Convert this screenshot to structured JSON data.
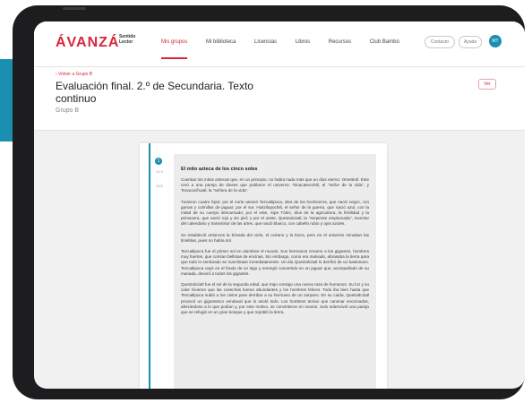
{
  "header": {
    "logo": "ÁVANZÁ",
    "logo_sub": "Sentido Lector",
    "nav": [
      "Mis grupos",
      "Mi biblioteca",
      "Licencias",
      "Libros",
      "Recursos",
      "Club Bambú"
    ],
    "active_nav": "Mis grupos",
    "contact": "Contacto",
    "help": "Ayuda",
    "avatar_initials": "MT"
  },
  "page": {
    "back_link": "‹ Volver a Grupo B",
    "title": "Evaluación final. 2.º de Secundaria. Texto continuo",
    "group": "Grupo B",
    "ver_button": "Ver"
  },
  "document": {
    "step": "1",
    "meta1": "11:3",
    "meta2": "2/20",
    "title": "El mito azteca de los cinco soles",
    "paragraphs": [
      "Cuentan los mitos aztecas que, en un principio, no había nada más que un dios eterno: Ometéotl. Este creó a una pareja de dioses que poblaron el universo: Tonacatecuhtli, el \"señor de la vida\", y Tonacacíhuatl, la \"señora de la vida\".",
      "Tuvieron cuatro hijos: por el norte asomó Tezcatlipoca, dios de los hechiceros, que nació negro, con garras y colmillos de jaguar; por el sur, Huitzilopochtli, el señor de la guerra, que nació azul, con la mitad de su cuerpo descarnado; por el este, Xipe Tótec, dios de la agricultura, la fertilidad y la primavera, que nació rojo y sin piel; y por el oeste, Quetzalcóatl, la \"serpiente emplumada\", inventor del calendario y transmisor de las artes, que nació blanco, con cabello rubio y ojos azules.",
      "Se estableció entonces la bóveda del cielo, el océano y la tierra, pero en el universo reinaban las tinieblas, pues no había sol.",
      "Tezcatlipoca fue el primer sol en alumbrar el mundo. Sus hermanos crearon a los gigantes, hombres muy fuertes, que comían bellotas de encinas. Sin embargo, como era malvado, abrasaba la tierra para que todo lo sembrado se marchitase inmediatamente. Un día Quetzalcóatl lo derribó de un bastonazo. Tezcatlipoca cayó en el fondo de un lago y emergió convertido en un jaguar que, acompañado de su manada, devoró a todos los gigantes.",
      "Quetzalcóatl fue el sol de la segunda edad, que trajo consigo una nueva raza de humanos. Su luz y su calor hicieron que las cosechas fueran abundantes y los hombres felices. Todo iba bien hasta que Tezcatlipoca subió a los cielos para derribar a su hermano de un zarpazo. En su caída, Quetzalcóatl provocó un gigantesco vendaval que lo asoló todo. Los hombres tenían que caminar encorvados, aferrándose a lo que podían y, por este motivo, se convirtieron en monos. Solo sobrevivió una pareja que se refugió en un gran bosque y que repobló la tierra."
    ]
  }
}
